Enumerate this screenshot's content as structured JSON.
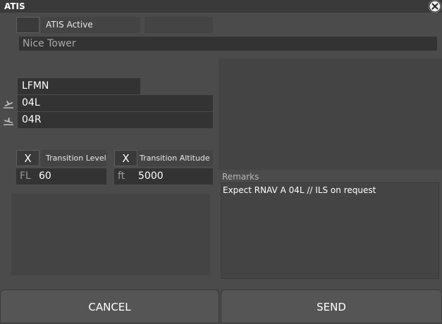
{
  "window": {
    "title": "ATIS",
    "close_icon": "close-icon"
  },
  "atis_active": {
    "label": "ATIS Active",
    "checked": false
  },
  "station_name": "Nice Tower",
  "airport": {
    "icao": "LFMN"
  },
  "runways": {
    "departure": "04L",
    "arrival": "04R",
    "departure_icon": "takeoff-icon",
    "arrival_icon": "landing-icon"
  },
  "transition_level": {
    "checkbox": "X",
    "label": "Transition Level",
    "unit": "FL",
    "value": "60"
  },
  "transition_altitude": {
    "checkbox": "X",
    "label": "Transition Altitude",
    "unit": "ft",
    "value": "5000"
  },
  "remarks": {
    "label": "Remarks",
    "text": "Expect RNAV A 04L // ILS on request"
  },
  "buttons": {
    "cancel": "CANCEL",
    "send": "SEND"
  },
  "colors": {
    "background": "#4b4b4b",
    "field": "#333333",
    "panel": "#444444",
    "button": "#555555"
  }
}
